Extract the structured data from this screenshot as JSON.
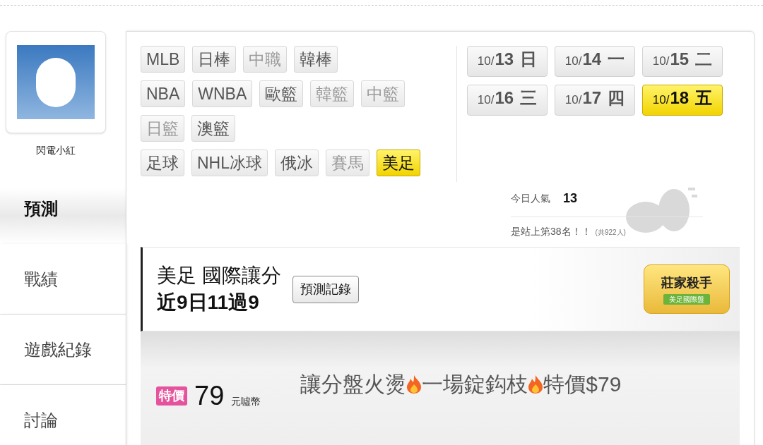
{
  "profile": {
    "name": "閃電小紅"
  },
  "nav": [
    {
      "label": "預測",
      "selected": true
    },
    {
      "label": "戰績",
      "selected": false
    },
    {
      "label": "遊戲紀錄",
      "selected": false
    },
    {
      "label": "討論",
      "selected": false
    }
  ],
  "sport_rows": [
    [
      {
        "label": "MLB",
        "disabled": false,
        "selected": false
      },
      {
        "label": "日棒",
        "disabled": false,
        "selected": false
      },
      {
        "label": "中職",
        "disabled": true,
        "selected": false
      },
      {
        "label": "韓棒",
        "disabled": false,
        "selected": false
      }
    ],
    [
      {
        "label": "NBA",
        "disabled": false,
        "selected": false
      },
      {
        "label": "WNBA",
        "disabled": false,
        "selected": false
      },
      {
        "label": "歐籃",
        "disabled": false,
        "selected": false
      },
      {
        "label": "韓籃",
        "disabled": true,
        "selected": false
      },
      {
        "label": "中籃",
        "disabled": true,
        "selected": false
      }
    ],
    [
      {
        "label": "日籃",
        "disabled": true,
        "selected": false
      },
      {
        "label": "澳籃",
        "disabled": false,
        "selected": false
      }
    ],
    [
      {
        "label": "足球",
        "disabled": false,
        "selected": false
      },
      {
        "label": "NHL冰球",
        "disabled": false,
        "selected": false
      },
      {
        "label": "俄冰",
        "disabled": false,
        "selected": false
      },
      {
        "label": "賽馬",
        "disabled": true,
        "selected": false
      },
      {
        "label": "美足",
        "disabled": false,
        "selected": true
      }
    ]
  ],
  "dates": [
    {
      "month": "10/",
      "day": "13",
      "weekday": "日",
      "selected": false
    },
    {
      "month": "10/",
      "day": "14",
      "weekday": "一",
      "selected": false
    },
    {
      "month": "10/",
      "day": "15",
      "weekday": "二",
      "selected": false
    },
    {
      "month": "10/",
      "day": "16",
      "weekday": "三",
      "selected": false
    },
    {
      "month": "10/",
      "day": "17",
      "weekday": "四",
      "selected": false
    },
    {
      "month": "10/",
      "day": "18",
      "weekday": "五",
      "selected": true
    }
  ],
  "stats": {
    "popularity_label": "今日人氣",
    "popularity_value": "13",
    "rank_text": "是站上第38名！！",
    "rank_total": "(共922人)"
  },
  "record": {
    "title": "美足 國際讓分",
    "streak": "近9日11過9",
    "history_button": "預測記錄",
    "badge_title": "莊家殺手",
    "badge_subtitle": "美足國際盤"
  },
  "offer": {
    "tag": "特價",
    "price": "79",
    "currency": "元噓幣",
    "title_parts": [
      "讓分盤火燙",
      "一場錠鈎枝",
      "特價$79"
    ]
  }
}
